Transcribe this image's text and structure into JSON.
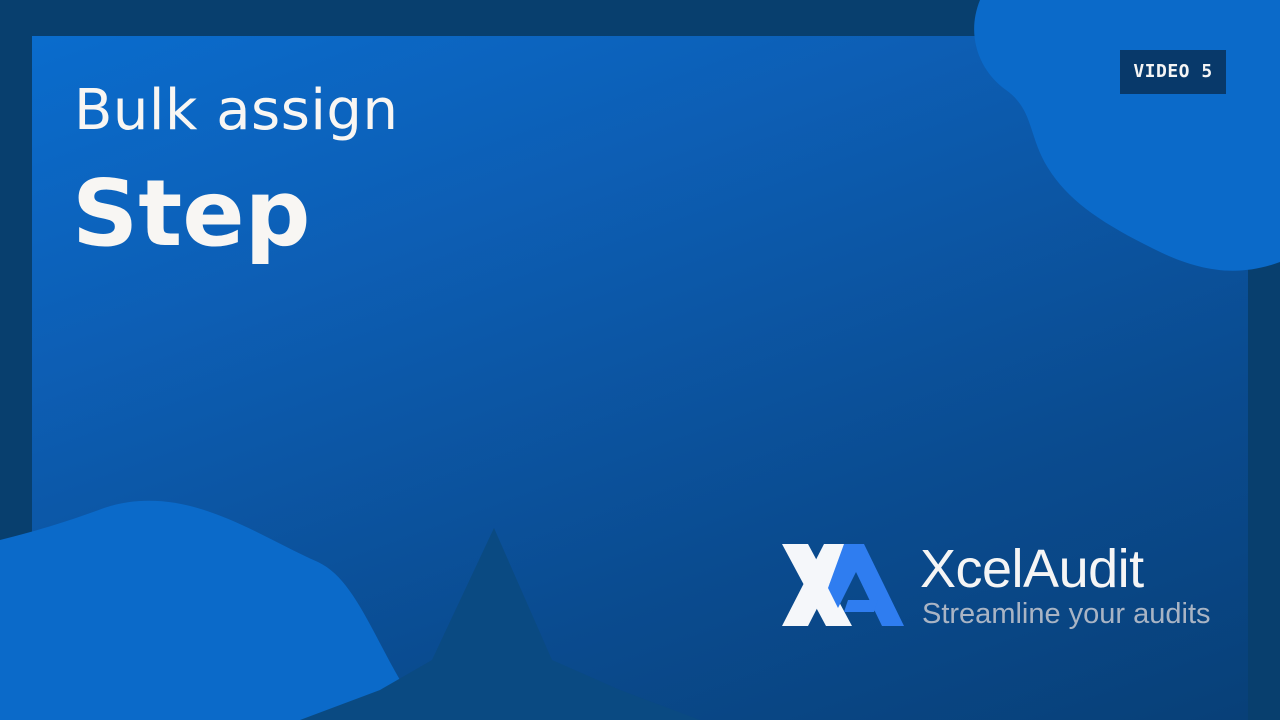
{
  "slide": {
    "title_line1": "Bulk assign",
    "title_line2": "Step",
    "badge": "VIDEO 5"
  },
  "brand": {
    "name": "XcelAudit",
    "tagline": "Streamline your audits",
    "logo_icon": "xa-monogram-icon"
  },
  "colors": {
    "frame": "#083f6e",
    "panel_light": "#0a6ccd",
    "panel_dark": "#084078",
    "blob": "#0b6ac9",
    "badge_bg": "#08396a",
    "text": "#f8f6f3",
    "tagline": "#a9b4c4",
    "logo_accent": "#2f7df0"
  }
}
